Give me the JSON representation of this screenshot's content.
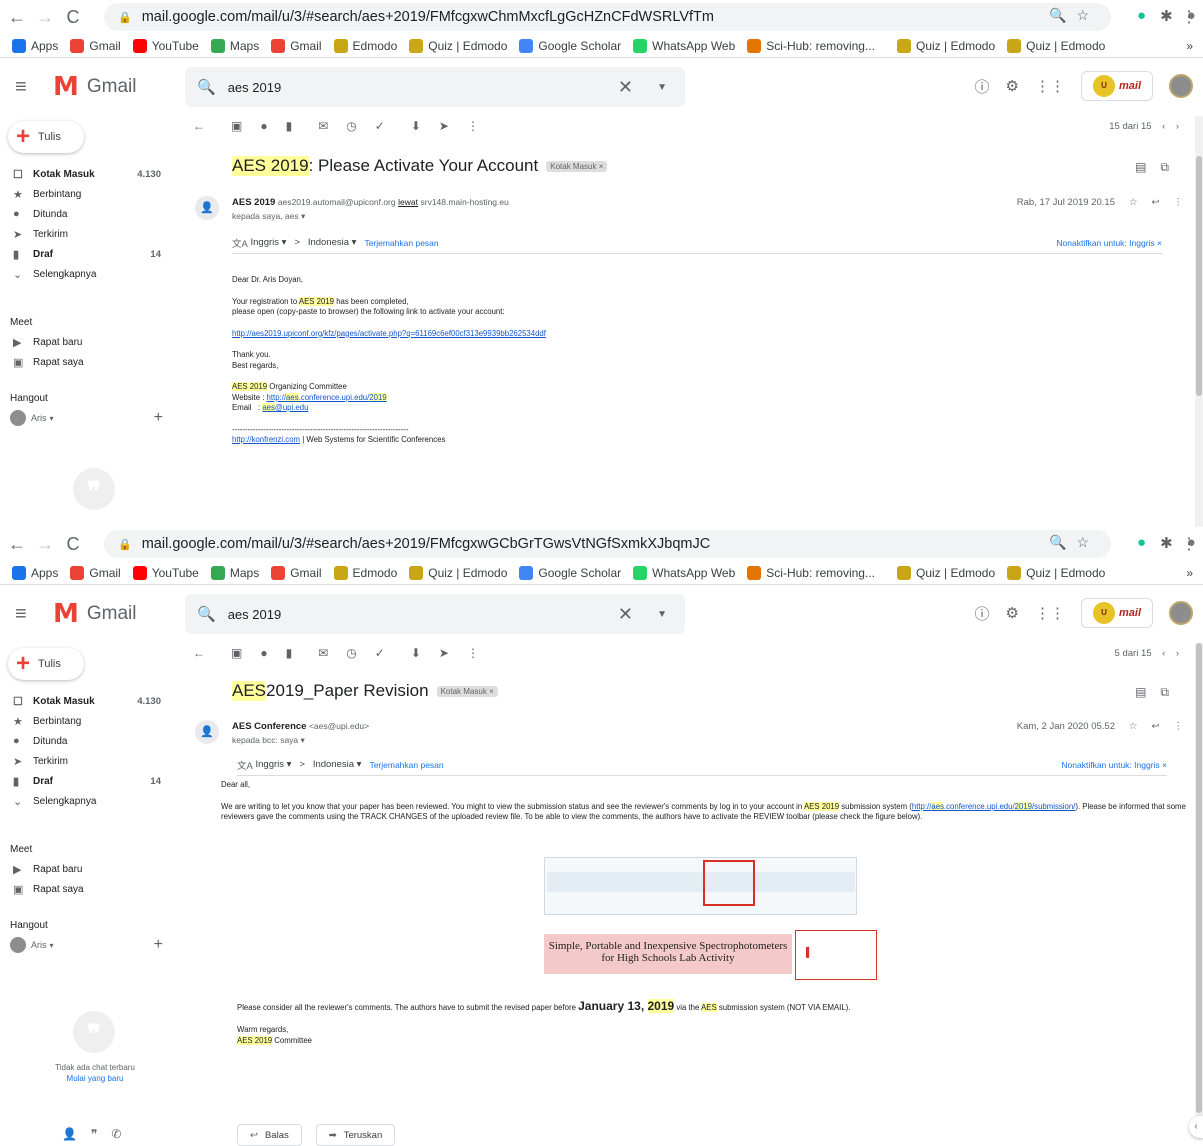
{
  "browser": {
    "nav_icons": [
      "back-arrow",
      "forward-arrow",
      "reload"
    ],
    "bookmarks": [
      {
        "label": "Apps",
        "icon": "apps-grid",
        "color": "#1a73e8"
      },
      {
        "label": "Gmail",
        "icon": "gmail-m",
        "color": "#ea4335"
      },
      {
        "label": "YouTube",
        "icon": "youtube-play",
        "color": "#ff0000"
      },
      {
        "label": "Maps",
        "icon": "maps-pin",
        "color": "#34a853"
      },
      {
        "label": "Gmail",
        "icon": "gmail-m",
        "color": "#ea4335"
      },
      {
        "label": "Edmodo",
        "icon": "edmodo-e",
        "color": "#c8a616"
      },
      {
        "label": "Quiz | Edmodo",
        "icon": "edmodo-e",
        "color": "#c8a616"
      },
      {
        "label": "Google Scholar",
        "icon": "scholar-cap",
        "color": "#4285f4"
      },
      {
        "label": "WhatsApp Web",
        "icon": "whatsapp",
        "color": "#25d366"
      },
      {
        "label": "Sci-Hub: removing...",
        "icon": "scihub-bird",
        "color": "#e37400"
      },
      {
        "label": "Quiz | Edmodo",
        "icon": "edmodo-e",
        "color": "#c8a616"
      },
      {
        "label": "Quiz | Edmodo",
        "icon": "edmodo-e",
        "color": "#c8a616"
      }
    ],
    "more_bookmarks": "»"
  },
  "gmail": {
    "app_name": "Gmail",
    "search_value": "aes 2019",
    "compose_label": "Tulis",
    "nav": [
      {
        "label": "Kotak Masuk",
        "count": "4.130",
        "bold": true,
        "icon": "inbox-icon"
      },
      {
        "label": "Berbintang",
        "count": "",
        "bold": false,
        "icon": "star-icon"
      },
      {
        "label": "Ditunda",
        "count": "",
        "bold": false,
        "icon": "clock-icon"
      },
      {
        "label": "Terkirim",
        "count": "",
        "bold": false,
        "icon": "send-icon"
      },
      {
        "label": "Draf",
        "count": "14",
        "bold": true,
        "icon": "draft-icon"
      },
      {
        "label": "Selengkapnya",
        "count": "",
        "bold": false,
        "icon": "chevron-down-icon"
      }
    ],
    "meet_title": "Meet",
    "meet_items": [
      "Rapat baru",
      "Rapat saya"
    ],
    "hangout_title": "Hangout",
    "hangout_user": "Aris",
    "no_chat": "Tidak ada chat terbaru",
    "start_new": "Mulai yang baru",
    "translate": {
      "from_lang": "Inggris",
      "arrow": ">",
      "to_lang": "Indonesia",
      "translate_link": "Terjemahkan pesan",
      "disable": "Nonaktifkan untuk: Inggris"
    },
    "inbox_label": "Kotak Masuk",
    "reply_label": "Balas",
    "forward_label": "Teruskan"
  },
  "window1": {
    "url": "mail.google.com/mail/u/3/#search/aes+2019/FMfcgxwChmMxcfLgGcHZnCFdWSRLVfTm",
    "counter": "15 dari 15",
    "subject_hl": "AES 2019",
    "subject_rest": " : Please Activate Your Account",
    "sender_name": "AES 2019",
    "sender_email": "aes2019.automail@upiconf.org",
    "via_label": "lewat",
    "via_host": "srv148.main-hosting.eu",
    "to_line": "kepada saya, aes",
    "date": "Rab, 17 Jul 2019 20.15",
    "body": {
      "greeting": "Dear Dr. Aris Doyan,",
      "line1_pre": "Your registration to ",
      "line1_hl": "AES 2019",
      "line1_post": " has been completed,",
      "line2": "please open (copy-paste to browser) the following link to activate your account:",
      "link": "http://aes2019.upiconf.org/kfz/pages/activate.php?q=61169c6ef00cf313e9939bb262534ddf",
      "thanks": "Thank you.",
      "regards": "Best regards,",
      "committee_hl": "AES 2019",
      "committee_rest": " Organizing Committee",
      "website_label": "Website : ",
      "website_pre": "http://",
      "website_hl": "aes",
      "website_mid": ".conference.upi.edu/",
      "website_hl2": "2019",
      "email_label": "Email   : ",
      "email_hl": "aes",
      "email_rest": "@upi.edu",
      "dashes": "--------------------------------------------------------------------",
      "footer_link": "http://konfrenzi.com",
      "footer_rest": " | Web Systems for Scientific Conferences"
    }
  },
  "window2": {
    "url": "mail.google.com/mail/u/3/#search/aes+2019/FMfcgxwGCbGrTGwsVtNGfSxmkXJbqmJC",
    "counter": "5 dari 15",
    "subject_hl": "AES",
    "subject_rest": " 2019_Paper Revision",
    "sender_name": "AES Conference",
    "sender_email": "<aes@upi.edu>",
    "to_line": "kepada bcc: saya",
    "date": "Kam, 2 Jan 2020 05.52",
    "body": {
      "greeting": "Dear all,",
      "p1_a": "We are writing to let you know that your paper has been reviewed. You might to view the submission status and see the reviewer's comments by log in to your account in ",
      "p1_hl": "AES 2019",
      "p1_b": " submission system (",
      "p1_link_a": "http://",
      "p1_link_hl": "aes",
      "p1_link_b": ".conference.upi.",
      "p1_link_c": "edu/",
      "p1_link_hl2": "2019",
      "p1_link_d": "/submission/",
      "p1_c": "). Please be informed that some reviewers gave the comments using the TRACK CHANGES of the uploaded review file. To be able to view the comments, the authors have to activate the REVIEW toolbar (please check the figure below).",
      "fig_title_1": "Simple, Portable and Inexpensive Spectrophotometers",
      "fig_title_2": "for High Schools Lab Activity",
      "p2_a": "Please consider all the reviewer's comments. The authors have to submit the revised paper before ",
      "p2_big": "January 13, ",
      "p2_big_hl": "2019",
      "p2_b": " via the ",
      "p2_hl": "AES",
      "p2_c": " submission system (NOT VIA EMAIL).",
      "warm": "Warm regards,",
      "sign_hl": "AES 2019",
      "sign_rest": " Committee"
    }
  }
}
